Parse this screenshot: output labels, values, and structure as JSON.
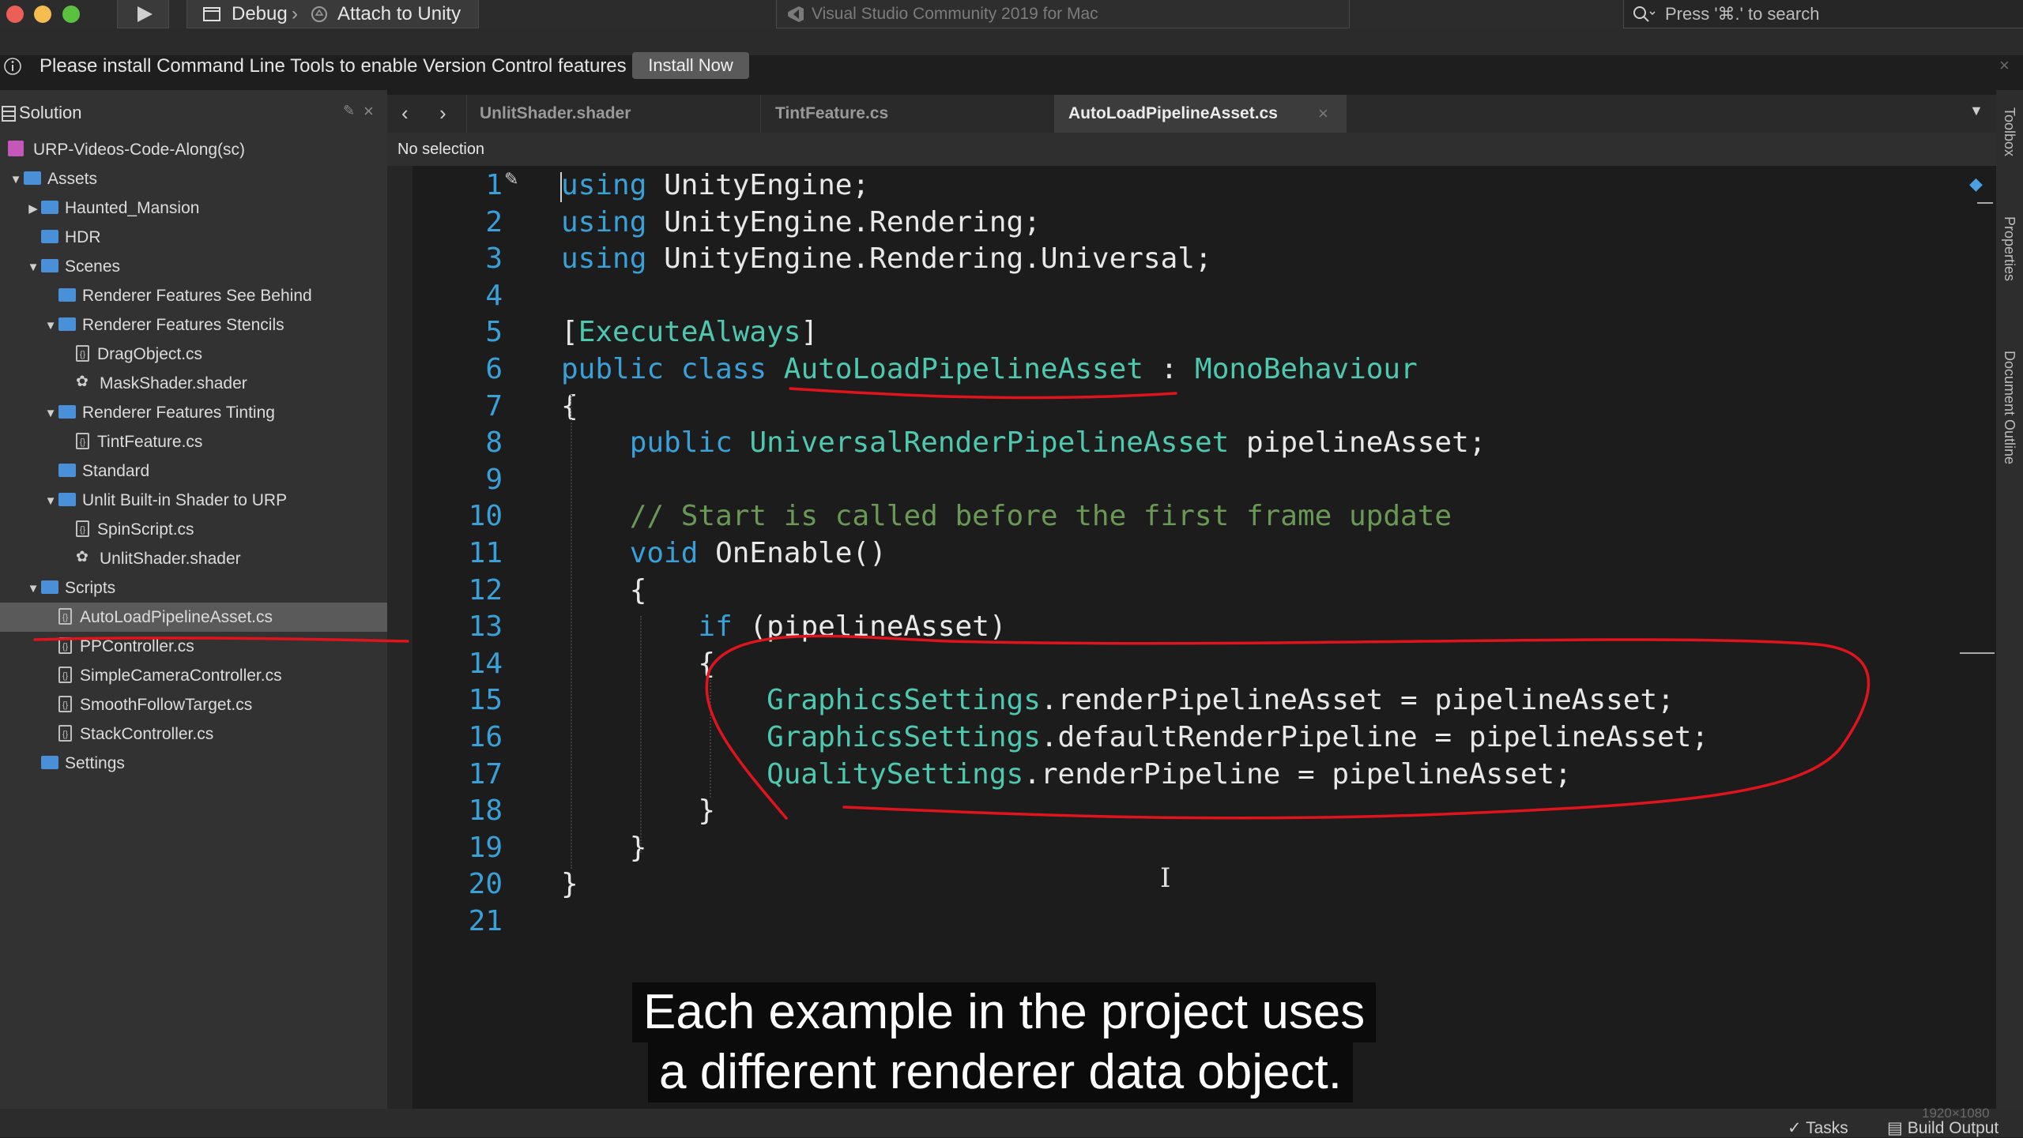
{
  "toolbar": {
    "config": "Debug",
    "separator": "›",
    "attach": "Attach to Unity",
    "window_title": "Visual Studio Community 2019 for Mac",
    "search_placeholder": "Press '⌘.' to search"
  },
  "infobar": {
    "message": "Please install Command Line Tools to enable Version Control features",
    "button": "Install Now"
  },
  "solution": {
    "header": "Solution",
    "project": "URP-Videos-Code-Along(sc)",
    "items": [
      {
        "label": "Assets",
        "kind": "folder",
        "indent": 0,
        "arrow": "▼"
      },
      {
        "label": "Haunted_Mansion",
        "kind": "folder",
        "indent": 1,
        "arrow": "▶"
      },
      {
        "label": "HDR",
        "kind": "folder",
        "indent": 1,
        "arrow": ""
      },
      {
        "label": "Scenes",
        "kind": "folder",
        "indent": 1,
        "arrow": "▼"
      },
      {
        "label": "Renderer Features See Behind",
        "kind": "folder",
        "indent": 2,
        "arrow": ""
      },
      {
        "label": "Renderer Features Stencils",
        "kind": "folder",
        "indent": 2,
        "arrow": "▼"
      },
      {
        "label": "DragObject.cs",
        "kind": "cs",
        "indent": 3,
        "arrow": ""
      },
      {
        "label": "MaskShader.shader",
        "kind": "shader",
        "indent": 3,
        "arrow": ""
      },
      {
        "label": "Renderer Features Tinting",
        "kind": "folder",
        "indent": 2,
        "arrow": "▼"
      },
      {
        "label": "TintFeature.cs",
        "kind": "cs",
        "indent": 3,
        "arrow": ""
      },
      {
        "label": "Standard",
        "kind": "folder",
        "indent": 2,
        "arrow": ""
      },
      {
        "label": "Unlit Built-in Shader to URP",
        "kind": "folder",
        "indent": 2,
        "arrow": "▼"
      },
      {
        "label": "SpinScript.cs",
        "kind": "cs",
        "indent": 3,
        "arrow": ""
      },
      {
        "label": "UnlitShader.shader",
        "kind": "shader",
        "indent": 3,
        "arrow": ""
      },
      {
        "label": "Scripts",
        "kind": "folder",
        "indent": 1,
        "arrow": "▼"
      },
      {
        "label": "AutoLoadPipelineAsset.cs",
        "kind": "cs",
        "indent": 2,
        "arrow": "",
        "selected": true
      },
      {
        "label": "PPController.cs",
        "kind": "cs",
        "indent": 2,
        "arrow": ""
      },
      {
        "label": "SimpleCameraController.cs",
        "kind": "cs",
        "indent": 2,
        "arrow": ""
      },
      {
        "label": "SmoothFollowTarget.cs",
        "kind": "cs",
        "indent": 2,
        "arrow": ""
      },
      {
        "label": "StackController.cs",
        "kind": "cs",
        "indent": 2,
        "arrow": ""
      },
      {
        "label": "Settings",
        "kind": "folder",
        "indent": 1,
        "arrow": ""
      }
    ]
  },
  "tabs": [
    {
      "label": "UnlitShader.shader"
    },
    {
      "label": "TintFeature.cs"
    },
    {
      "label": "AutoLoadPipelineAsset.cs",
      "active": true
    }
  ],
  "editor": {
    "selection": "No selection",
    "line_numbers": [
      "1",
      "2",
      "3",
      "4",
      "5",
      "6",
      "7",
      "8",
      "9",
      "10",
      "11",
      "12",
      "13",
      "14",
      "15",
      "16",
      "17",
      "18",
      "19",
      "20",
      "21"
    ],
    "lines": [
      [
        [
          "kw",
          "using"
        ],
        [
          "",
          "UnityEngine;"
        ]
      ],
      [
        [
          "kw",
          "using"
        ],
        [
          "",
          "UnityEngine.Rendering;"
        ]
      ],
      [
        [
          "kw",
          "using"
        ],
        [
          "",
          "UnityEngine.Rendering.Universal;"
        ]
      ],
      [],
      [
        [
          "",
          "["
        ],
        [
          "ty",
          "ExecuteAlways"
        ],
        [
          "",
          "]"
        ]
      ],
      [
        [
          "kw",
          "public"
        ],
        [
          "kw",
          "class"
        ],
        [
          "ty",
          "AutoLoadPipelineAsset"
        ],
        [
          "",
          ":"
        ],
        [
          "ty",
          "MonoBehaviour"
        ]
      ],
      [
        [
          "",
          "{"
        ]
      ],
      [
        [
          "kw",
          "    public"
        ],
        [
          "ty",
          "UniversalRenderPipelineAsset"
        ],
        [
          "",
          "pipelineAsset;"
        ]
      ],
      [],
      [
        [
          "cm",
          "    // Start is called before the first frame update"
        ]
      ],
      [
        [
          "kw",
          "    void"
        ],
        [
          "",
          "OnEnable()"
        ]
      ],
      [
        [
          "",
          "    {"
        ]
      ],
      [
        [
          "kw",
          "        if"
        ],
        [
          "",
          "(pipelineAsset)"
        ]
      ],
      [
        [
          "",
          "        {"
        ]
      ],
      [
        [
          "ty",
          "            GraphicsSettings"
        ],
        [
          "",
          ".renderPipelineAsset = pipelineAsset;"
        ]
      ],
      [
        [
          "ty",
          "            GraphicsSettings"
        ],
        [
          "",
          ".defaultRenderPipeline = pipelineAsset;"
        ]
      ],
      [
        [
          "ty",
          "            QualitySettings"
        ],
        [
          "",
          ".renderPipeline = pipelineAsset;"
        ]
      ],
      [
        [
          "",
          "        }"
        ]
      ],
      [
        [
          "",
          "    }"
        ]
      ],
      [
        [
          "",
          "}"
        ]
      ],
      []
    ]
  },
  "right_tools": [
    "Toolbox",
    "Properties",
    "Document Outline"
  ],
  "statusbar": {
    "resolution": "1920×1080",
    "tasks": "Tasks",
    "build_output": "Build Output"
  },
  "subtitle": {
    "line1": "Each example in the project uses",
    "line2": "a different renderer data object."
  },
  "colors": {
    "accent_blue": "#3aa0d8",
    "type_teal": "#4ec9b0",
    "comment_green": "#6a9955",
    "annotation_red": "#e0141c"
  }
}
